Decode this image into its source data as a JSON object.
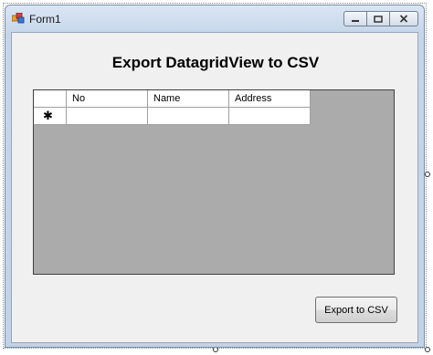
{
  "window": {
    "title": "Form1"
  },
  "form": {
    "heading": "Export DatagridView to CSV"
  },
  "grid": {
    "columns": [
      "No",
      "Name",
      "Address"
    ],
    "new_row_marker": "✱",
    "rows": []
  },
  "actions": {
    "export_label": "Export to CSV"
  },
  "colors": {
    "grid_background": "#ababab",
    "client_background": "#f0f0f0"
  }
}
